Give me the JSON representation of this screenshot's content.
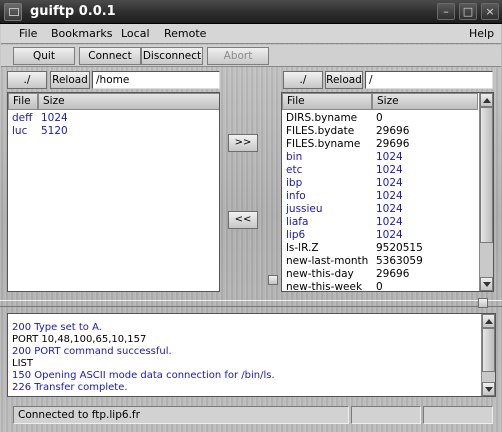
{
  "window": {
    "title": "guiftp 0.0.1",
    "minimize_glyph": "–",
    "maximize_glyph": "□",
    "close_glyph": "×"
  },
  "menubar": {
    "file": "File",
    "bookmarks": "Bookmarks",
    "local": "Local",
    "remote": "Remote",
    "help": "Help"
  },
  "toolbar": {
    "quit": "Quit",
    "connect": "Connect",
    "disconnect": "Disconnect",
    "abort": "Abort"
  },
  "local": {
    "home_glyph": "./",
    "reload": "Reload",
    "path": "/home",
    "columns": [
      "File",
      "Size"
    ],
    "rows": [
      {
        "name": "deff",
        "size": "1024",
        "type": "dir"
      },
      {
        "name": "luc",
        "size": "5120",
        "type": "dir"
      }
    ]
  },
  "transfer": {
    "upload": ">>",
    "download": "<<"
  },
  "remote": {
    "home_glyph": "./",
    "reload": "Reload",
    "path": "/",
    "columns": [
      "File",
      "Size"
    ],
    "rows": [
      {
        "name": "DIRS.byname",
        "size": "0",
        "type": "file"
      },
      {
        "name": "FILES.bydate",
        "size": "29696",
        "type": "file"
      },
      {
        "name": "FILES.byname",
        "size": "29696",
        "type": "file"
      },
      {
        "name": "bin",
        "size": "1024",
        "type": "dir"
      },
      {
        "name": "etc",
        "size": "1024",
        "type": "dir"
      },
      {
        "name": "ibp",
        "size": "1024",
        "type": "dir"
      },
      {
        "name": "info",
        "size": "1024",
        "type": "dir"
      },
      {
        "name": "jussieu",
        "size": "1024",
        "type": "dir"
      },
      {
        "name": "liafa",
        "size": "1024",
        "type": "dir"
      },
      {
        "name": "lip6",
        "size": "1024",
        "type": "dir"
      },
      {
        "name": "ls-lR.Z",
        "size": "9520515",
        "type": "file"
      },
      {
        "name": "new-last-month",
        "size": "5363059",
        "type": "file"
      },
      {
        "name": "new-this-day",
        "size": "29696",
        "type": "file"
      },
      {
        "name": "new-this-week",
        "size": "0",
        "type": "file"
      }
    ]
  },
  "log": [
    {
      "text": "200 Type set to A.",
      "kind": "reply"
    },
    {
      "text": "PORT 10,48,100,65,10,157",
      "kind": "command"
    },
    {
      "text": "200 PORT command successful.",
      "kind": "reply"
    },
    {
      "text": "LIST",
      "kind": "command"
    },
    {
      "text": "150 Opening ASCII mode data connection for /bin/ls.",
      "kind": "reply"
    },
    {
      "text": "226 Transfer complete.",
      "kind": "reply"
    }
  ],
  "status": {
    "message": "Connected to ftp.lip6.fr",
    "field2": "",
    "field3": ""
  },
  "colors": {
    "dir": "#1a1ab4",
    "file": "#000000",
    "reply": "#1a1ab4",
    "command": "#000000"
  }
}
